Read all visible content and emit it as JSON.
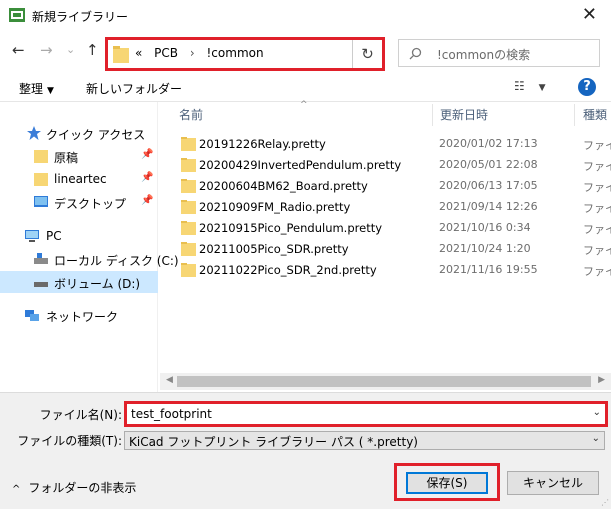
{
  "window": {
    "title": "新規ライブラリー",
    "close_glyph": "✕"
  },
  "nav": {
    "back": "←",
    "forward": "→",
    "recent": "⌄",
    "up": "↑",
    "breadcrumb": {
      "overflow": "«",
      "items": [
        "PCB",
        "!common"
      ],
      "sep": "›"
    },
    "refresh": "↻",
    "search_placeholder": "!commonの検索"
  },
  "toolbar": {
    "organize": "整理",
    "new_folder": "新しいフォルダー",
    "help": "?"
  },
  "sidebar": {
    "quick_access": "クイック アクセス",
    "pinned": [
      "原稿",
      "lineartec",
      "デスクトップ"
    ],
    "pc": "PC",
    "drives": [
      "ローカル ディスク (C:)",
      "ボリューム (D:)"
    ],
    "network": "ネットワーク"
  },
  "columns": {
    "name": "名前",
    "date": "更新日時",
    "type": "種類"
  },
  "files": [
    {
      "name": "20191226Relay.pretty",
      "date": "2020/01/02 17:13",
      "type": "ファイ"
    },
    {
      "name": "20200429InvertedPendulum.pretty",
      "date": "2020/05/01 22:08",
      "type": "ファイ"
    },
    {
      "name": "20200604BM62_Board.pretty",
      "date": "2020/06/13 17:05",
      "type": "ファイ"
    },
    {
      "name": "20210909FM_Radio.pretty",
      "date": "2021/09/14 12:26",
      "type": "ファイ"
    },
    {
      "name": "20210915Pico_Pendulum.pretty",
      "date": "2021/10/16 0:34",
      "type": "ファイ"
    },
    {
      "name": "20211005Pico_SDR.pretty",
      "date": "2021/10/24 1:20",
      "type": "ファイ"
    },
    {
      "name": "20211022Pico_SDR_2nd.pretty",
      "date": "2021/11/16 19:55",
      "type": "ファイ"
    }
  ],
  "form": {
    "filename_label": "ファイル名(N):",
    "filename_value": "test_footprint",
    "filetype_label": "ファイルの種類(T):",
    "filetype_value": "KiCad フットプリント ライブラリー パス ( *.pretty)",
    "hide_folders": "フォルダーの非表示",
    "save": "保存(S)",
    "cancel": "キャンセル"
  },
  "colors": {
    "highlight": "#e0202a",
    "selection": "#cce8ff",
    "folder": "#f7d674",
    "accent": "#0078d7"
  }
}
